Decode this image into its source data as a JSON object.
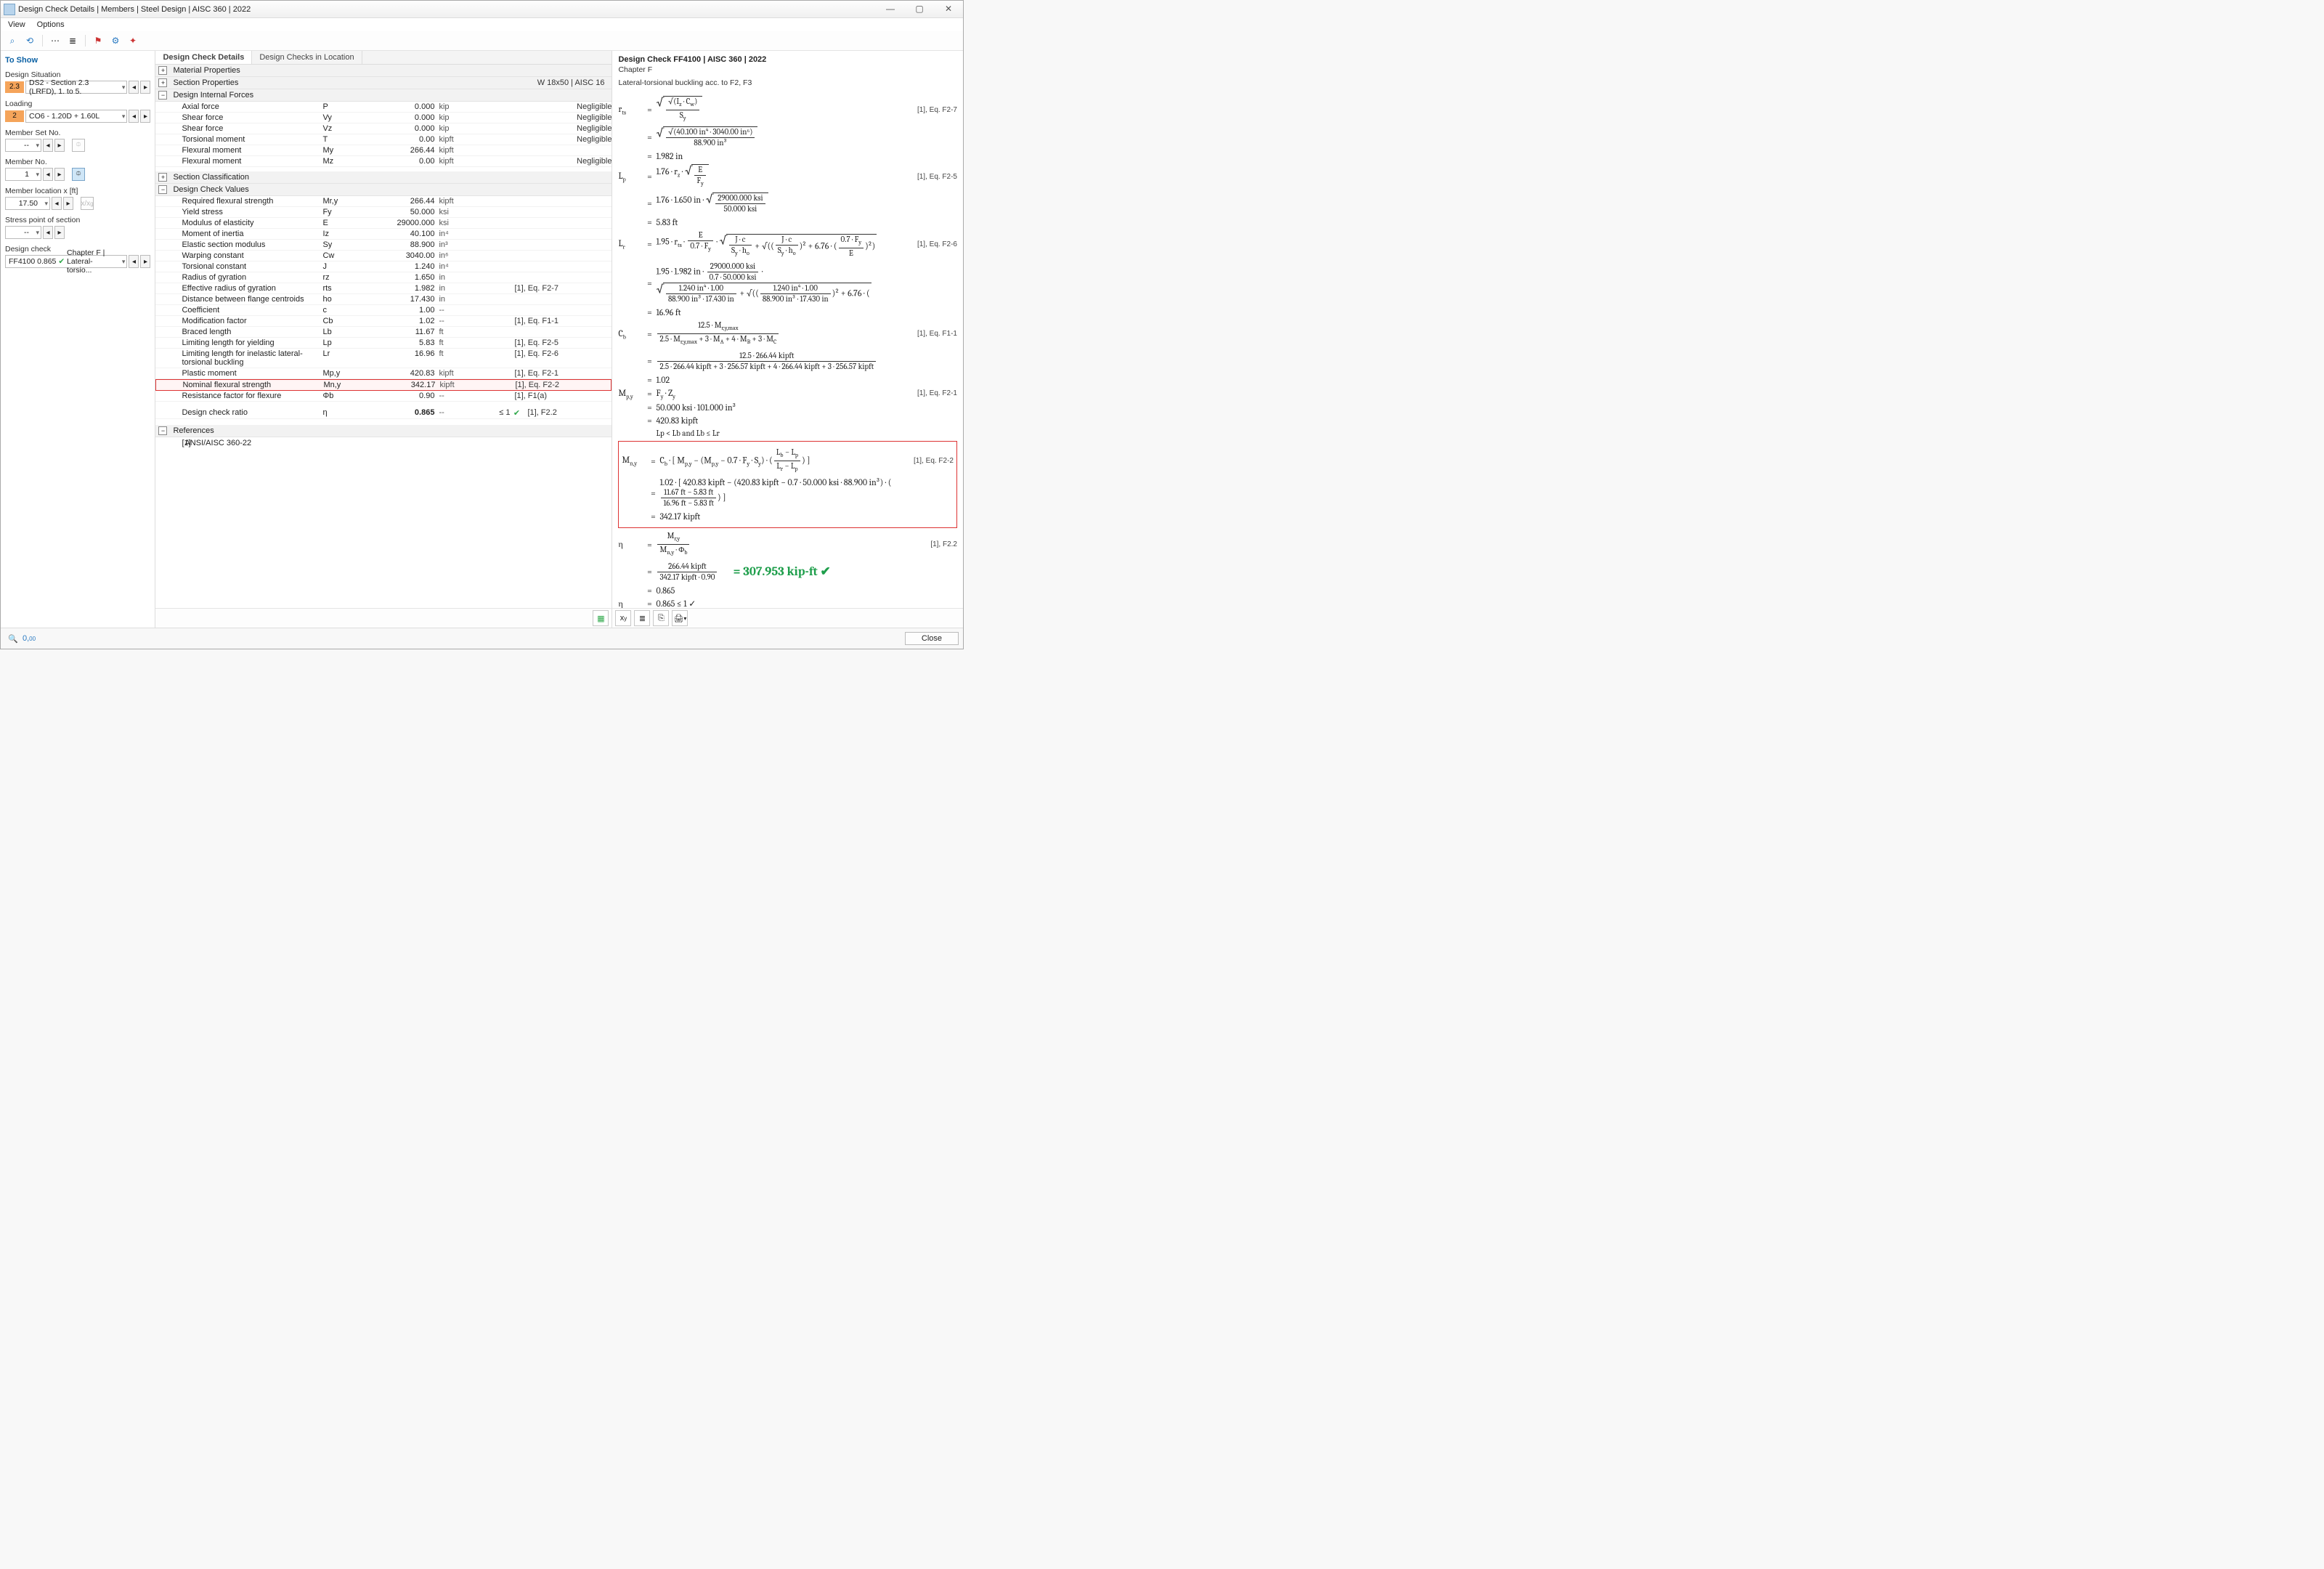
{
  "window": {
    "title": "Design Check Details | Members | Steel Design | AISC 360 | 2022"
  },
  "menu": {
    "view": "View",
    "options": "Options"
  },
  "left": {
    "title": "To Show",
    "design_situation_label": "Design Situation",
    "design_situation_pill": "2.3",
    "design_situation_value": "DS2 - Section 2.3 (LRFD), 1. to 5.",
    "loading_label": "Loading",
    "loading_pill": "2",
    "loading_value": "CO6 - 1.20D + 1.60L",
    "member_set_label": "Member Set No.",
    "member_set_value": "--",
    "member_no_label": "Member No.",
    "member_no_value": "1",
    "member_loc_label": "Member location x [ft]",
    "member_loc_value": "17.50",
    "stress_point_label": "Stress point of section",
    "stress_point_value": "--",
    "design_check_label": "Design check",
    "design_check_code": "FF4100",
    "design_check_ratio": "0.865",
    "design_check_text": "Chapter F | Lateral-torsio..."
  },
  "tabs": {
    "t1": "Design Check Details",
    "t2": "Design Checks in Location"
  },
  "section_props_right": "W 18x50 | AISC 16",
  "groups": {
    "g1": "Material Properties",
    "g2": "Section Properties",
    "g3": "Design Internal Forces",
    "g4": "Section Classification",
    "g5": "Design Check Values",
    "g6": "References"
  },
  "forces": [
    {
      "name": "Axial force",
      "sym": "P",
      "val": "0.000",
      "un": "kip",
      "ref": "Negligible"
    },
    {
      "name": "Shear force",
      "sym": "Vy",
      "val": "0.000",
      "un": "kip",
      "ref": "Negligible"
    },
    {
      "name": "Shear force",
      "sym": "Vz",
      "val": "0.000",
      "un": "kip",
      "ref": "Negligible"
    },
    {
      "name": "Torsional moment",
      "sym": "T",
      "val": "0.00",
      "un": "kipft",
      "ref": "Negligible"
    },
    {
      "name": "Flexural moment",
      "sym": "My",
      "val": "266.44",
      "un": "kipft",
      "ref": ""
    },
    {
      "name": "Flexural moment",
      "sym": "Mz",
      "val": "0.00",
      "un": "kipft",
      "ref": "Negligible"
    }
  ],
  "values": [
    {
      "name": "Required flexural strength",
      "sym": "Mr,y",
      "val": "266.44",
      "un": "kipft",
      "ref": ""
    },
    {
      "name": "Yield stress",
      "sym": "Fy",
      "val": "50.000",
      "un": "ksi",
      "ref": ""
    },
    {
      "name": "Modulus of elasticity",
      "sym": "E",
      "val": "29000.000",
      "un": "ksi",
      "ref": ""
    },
    {
      "name": "Moment of inertia",
      "sym": "Iz",
      "val": "40.100",
      "un": "in⁴",
      "ref": ""
    },
    {
      "name": "Elastic section modulus",
      "sym": "Sy",
      "val": "88.900",
      "un": "in³",
      "ref": "",
      "chk": true
    },
    {
      "name": "Warping constant",
      "sym": "Cw",
      "val": "3040.00",
      "un": "in⁶",
      "ref": ""
    },
    {
      "name": "Torsional constant",
      "sym": "J",
      "val": "1.240",
      "un": "in⁴",
      "ref": ""
    },
    {
      "name": "Radius of gyration",
      "sym": "rz",
      "val": "1.650",
      "un": "in",
      "ref": ""
    },
    {
      "name": "Effective radius of gyration",
      "sym": "rts",
      "val": "1.982",
      "un": "in",
      "ref": "[1], Eq. F2-7"
    },
    {
      "name": "Distance between flange centroids",
      "sym": "ho",
      "val": "17.430",
      "un": "in",
      "ref": ""
    },
    {
      "name": "Coefficient",
      "sym": "c",
      "val": "1.00",
      "un": "--",
      "ref": ""
    },
    {
      "name": "Modification factor",
      "sym": "Cb",
      "val": "1.02",
      "un": "--",
      "ref": "[1], Eq. F1-1"
    },
    {
      "name": "Braced length",
      "sym": "Lb",
      "val": "11.67",
      "un": "ft",
      "ref": ""
    },
    {
      "name": "Limiting length for yielding",
      "sym": "Lp",
      "val": "5.83",
      "un": "ft",
      "ref": "[1], Eq. F2-5"
    },
    {
      "name": "Limiting length for inelastic lateral-torsional buckling",
      "sym": "Lr",
      "val": "16.96",
      "un": "ft",
      "ref": "[1], Eq. F2-6"
    },
    {
      "name": "Plastic moment",
      "sym": "Mp,y",
      "val": "420.83",
      "un": "kipft",
      "ref": "[1], Eq. F2-1"
    },
    {
      "name": "Nominal flexural strength",
      "sym": "Mn,y",
      "val": "342.17",
      "un": "kipft",
      "ref": "[1], Eq. F2-2",
      "mark": true
    },
    {
      "name": "Resistance factor for flexure",
      "sym": "Φb",
      "val": "0.90",
      "un": "--",
      "ref": "[1], F1(a)"
    }
  ],
  "ratio": {
    "name": "Design check ratio",
    "sym": "η",
    "val": "0.865",
    "un": "--",
    "lim": "≤ 1",
    "ref": "[1], F2.2",
    "chk": true
  },
  "reference": {
    "idx": "[1]",
    "txt": "ANSI/AISC 360-22"
  },
  "right": {
    "title": "Design Check FF4100 | AISC 360 | 2022",
    "chapter": "Chapter F",
    "sub": "Lateral-torsional buckling acc. to F2, F3",
    "ann_result": "= 307.953 kip-ft  ✔",
    "refs": {
      "rts": "[1], Eq. F2-7",
      "lp": "[1], Eq. F2-5",
      "lr": "[1], Eq. F2-6",
      "cb": "[1], Eq. F1-1",
      "mpy": "[1], Eq. F2-1",
      "mny": "[1], Eq. F2-2",
      "eta": "[1], F2.2"
    },
    "legend": [
      {
        "s": "rts",
        "t": "Effective radius of gyration"
      },
      {
        "s": "Iz",
        "t": "Moment of inertia"
      },
      {
        "s": "Cw",
        "t": "Warping constant"
      },
      {
        "s": "Sy",
        "t": "Elastic section modulus"
      },
      {
        "s": "Lp",
        "t": "Limiting length for yielding"
      },
      {
        "s": "rz",
        "t": "Radius of gyration"
      },
      {
        "s": "E",
        "t": "Modulus of elasticity"
      },
      {
        "s": "Fy",
        "t": "Yield stress"
      },
      {
        "s": "Lr",
        "t": "Limiting length for inelastic lateral-torsional buckling"
      },
      {
        "s": "J",
        "t": "Torsional constant"
      }
    ]
  },
  "footer": {
    "close": "Close"
  },
  "calc": {
    "rts_num": "40.100 in⁴ · 3040.00 in⁶",
    "rts_den": "88.900 in³",
    "rts_res": "1.982 in",
    "lp_num": "29000.000 ksi",
    "lp_den": "50.000 ksi",
    "lp_pre": "1.76 · 1.650 in ·",
    "lp_res": "5.83 ft",
    "lr_pre": "1.95 · 1.982 in ·",
    "lr_f1n": "29000.000 ksi",
    "lr_f1d": "0.7 · 50.000 ksi",
    "lr_f2n": "1.240 in⁴ · 1.00",
    "lr_f2d": "88.900 in³ · 17.430 in",
    "lr_plus": "+ 6.76 · (",
    "lr_res": "16.96 ft",
    "cb_n": "12.5 · 266.44 kipft",
    "cb_d": "2.5 · 266.44 kipft + 3 · 256.57 kipft + 4 · 266.44 kipft + 3 · 256.57 kipft",
    "cb_res": "1.02",
    "mpy_expr": "50.000 ksi · 101.000 in³",
    "mpy_res": "420.83 kipft",
    "cond": "Lp < Lb and Lb ≤ Lr",
    "mny_line": "1.02 · [ 420.83 kipft − (420.83 kipft − 0.7 · 50.000 ksi · 88.900 in³) ·",
    "mny_fn": "11.67 ft − 5.83 ft",
    "mny_fd": "16.96 ft − 5.83 ft",
    "mny_res": "342.17 kipft",
    "eta_n": "266.44 kipft",
    "eta_d": "342.17 kipft · 0.90",
    "eta_res": "0.865",
    "eta_fin": "0.865 ≤ 1 ✓"
  }
}
